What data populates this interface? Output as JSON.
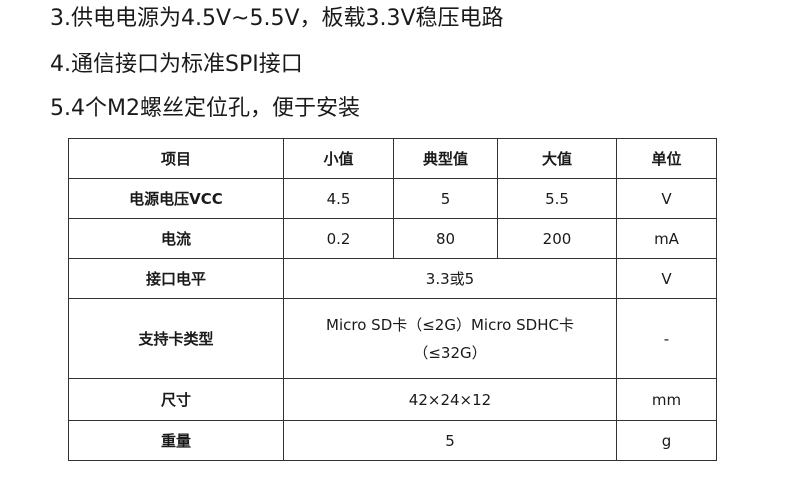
{
  "intro_lines": [
    "3.供电电源为4.5V~5.5V，板载3.3V稳压电路",
    "4.通信接口为标准SPI接口",
    "5.4个M2螺丝定位孔，便于安装"
  ],
  "table": {
    "headers": [
      "项目",
      "小值",
      "典型值",
      "大值",
      "单位"
    ],
    "rows": {
      "supply_voltage": {
        "label": "电源电压VCC",
        "min": "4.5",
        "typ": "5",
        "max": "5.5",
        "unit": "V"
      },
      "current": {
        "label": "电流",
        "min": "0.2",
        "typ": "80",
        "max": "200",
        "unit": "mA"
      },
      "interface_level": {
        "label": "接口电平",
        "value": "3.3或5",
        "unit": "V"
      },
      "card_type": {
        "label": "支持卡类型",
        "value_line1": "Micro SD卡（≤2G）Micro SDHC卡",
        "value_line2": "（≤32G）",
        "unit": "-"
      },
      "size": {
        "label": "尺寸",
        "value": "42×24×12",
        "unit": "mm"
      },
      "weight": {
        "label": "重量",
        "value": "5",
        "unit": "g"
      }
    }
  }
}
